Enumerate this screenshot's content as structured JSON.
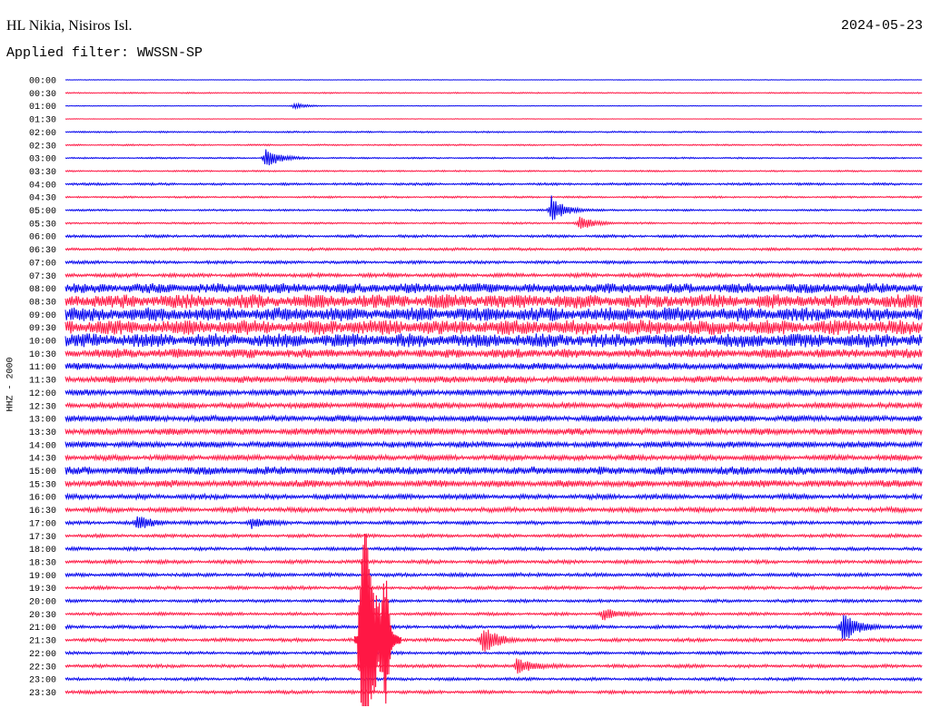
{
  "header": {
    "station": "HL Nikia, Nisiros Isl.",
    "date": "2024-05-23",
    "filter": "Applied filter: WWSSN-SP"
  },
  "chart_data": {
    "type": "line",
    "title": "HL Nikia, Nisiros Isl.",
    "ylabel": "HHZ - 2000",
    "trace_labels": [
      "00:00",
      "00:30",
      "01:00",
      "01:30",
      "02:00",
      "02:30",
      "03:00",
      "03:30",
      "04:00",
      "04:30",
      "05:00",
      "05:30",
      "06:00",
      "06:30",
      "07:00",
      "07:30",
      "08:00",
      "08:30",
      "09:00",
      "09:30",
      "10:00",
      "10:30",
      "11:00",
      "11:30",
      "12:00",
      "12:30",
      "13:00",
      "13:30",
      "14:00",
      "14:30",
      "15:00",
      "15:30",
      "16:00",
      "16:30",
      "17:00",
      "17:30",
      "18:00",
      "18:30",
      "19:00",
      "19:30",
      "20:00",
      "20:30",
      "21:00",
      "21:30",
      "22:00",
      "22:30",
      "23:00",
      "23:30"
    ],
    "trace_colors": [
      "#0000ee",
      "#ff1744"
    ],
    "noise_level": [
      0.2,
      0.4,
      0.2,
      0.2,
      0.5,
      0.5,
      0.5,
      0.5,
      0.8,
      0.6,
      0.6,
      0.6,
      0.9,
      0.9,
      1.0,
      1.3,
      3.2,
      4.5,
      4.5,
      4.8,
      4.5,
      3.0,
      2.2,
      2.2,
      2.0,
      1.9,
      2.0,
      2.2,
      2.0,
      1.8,
      2.6,
      2.3,
      1.6,
      1.6,
      1.2,
      1.1,
      1.1,
      1.2,
      1.2,
      1.1,
      1.0,
      1.0,
      1.1,
      1.1,
      1.0,
      1.1,
      1.0,
      1.1
    ],
    "events": [
      {
        "trace": "01:00",
        "minute": 8,
        "amplitude": 3
      },
      {
        "trace": "03:00",
        "minute": 7,
        "amplitude": 12
      },
      {
        "trace": "05:00",
        "minute": 17,
        "amplitude": 16
      },
      {
        "trace": "05:30",
        "minute": 18,
        "amplitude": 8
      },
      {
        "trace": "17:00",
        "minute": 2.5,
        "amplitude": 8
      },
      {
        "trace": "17:00",
        "minute": 6.5,
        "amplitude": 6
      },
      {
        "trace": "20:30",
        "minute": 18.8,
        "amplitude": 7
      },
      {
        "trace": "21:00",
        "minute": 27.2,
        "amplitude": 20
      },
      {
        "trace": "21:30",
        "minute": 14.6,
        "amplitude": 18
      },
      {
        "trace": "22:30",
        "minute": 15.8,
        "amplitude": 10
      }
    ],
    "major_event": {
      "trace": "21:30",
      "minute": 10.5,
      "amplitude": 150
    }
  }
}
